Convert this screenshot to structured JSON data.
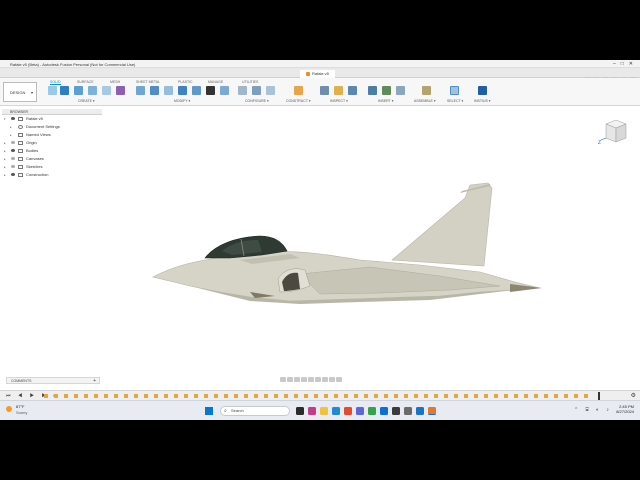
{
  "window": {
    "title": "Rafale v5 (Beta) - Autodesk Fusion Personal (Not for Commercial Use)",
    "controls": [
      "–",
      "□",
      "✕"
    ]
  },
  "document_tab": {
    "label": "Rafale v5"
  },
  "quick_access": "▦  ▤ ▾  ⤺ ▾  ⤻ ▾",
  "workspace_button": "DESIGN",
  "workspace_tabs": [
    "SOLID",
    "SURFACE",
    "MESH",
    "SHEET METAL",
    "PLASTIC",
    "MANAGE",
    "UTILITIES"
  ],
  "toolbar_groups": [
    "CREATE",
    "MODIFY",
    "CONFIGURE",
    "CONSTRUCT",
    "INSPECT",
    "INSERT",
    "ASSEMBLE",
    "SELECT",
    "INSTIUS"
  ],
  "browser": {
    "header": "BROWSER",
    "root": "Rafale v5",
    "items": [
      {
        "label": "Document Settings",
        "icon": "gear-icon"
      },
      {
        "label": "Named Views",
        "icon": "folder-icon"
      },
      {
        "label": "Origin",
        "icon": "folder-icon"
      },
      {
        "label": "Bodies",
        "icon": "folder-icon"
      },
      {
        "label": "Canvases",
        "icon": "folder-icon"
      },
      {
        "label": "Sketches",
        "icon": "folder-icon"
      },
      {
        "label": "Construction",
        "icon": "folder-icon"
      }
    ]
  },
  "viewcube": {
    "axis_label": "Z"
  },
  "comments": {
    "label": "COMMENTS"
  },
  "timeline": {
    "controls": "⏮ ◀ ▶ ▶ ⏭"
  },
  "taskbar": {
    "weather_temp": "87°F",
    "weather_desc": "Sunny",
    "search_placeholder": "Search",
    "time": "2:45 PM",
    "date": "8/27/2024"
  },
  "colors": {
    "accent": "#0696d7",
    "aircraft_body": "#cfcdbd",
    "canopy": "#2f3a33"
  }
}
